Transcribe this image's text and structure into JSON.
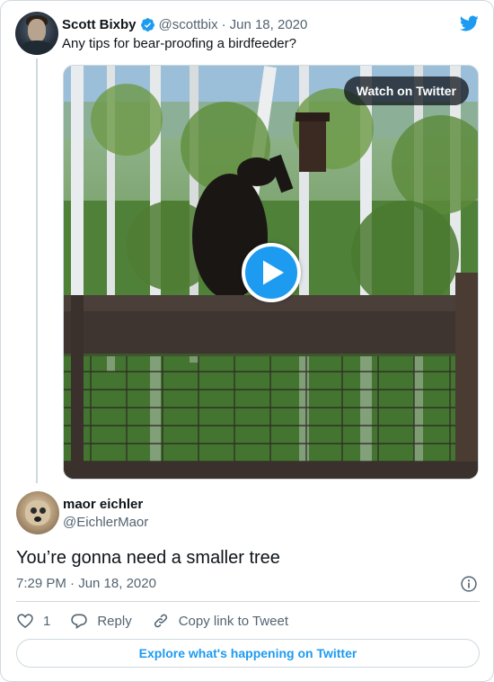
{
  "parent_tweet": {
    "author_name": "Scott Bixby",
    "handle": "@scottbix",
    "separator": "·",
    "date": "Jun 18, 2020",
    "text": "Any tips for bear-proofing a birdfeeder?"
  },
  "media": {
    "watch_label": "Watch on Twitter"
  },
  "reply_tweet": {
    "author_name": "maor eichler",
    "handle": "@EichlerMaor",
    "text": "You’re gonna need a smaller tree",
    "timestamp": "7:29 PM · Jun 18, 2020"
  },
  "actions": {
    "like_count": "1",
    "reply_label": "Reply",
    "copy_link_label": "Copy link to Tweet"
  },
  "footer": {
    "explore_label": "Explore what's happening on Twitter"
  },
  "colors": {
    "brand": "#1d9bf0",
    "text": "#0f1419",
    "secondary": "#536471",
    "border": "#cfd9de"
  },
  "icons": [
    "verified-icon",
    "twitter-bird-icon",
    "play-icon",
    "info-icon",
    "heart-icon",
    "reply-bubble-icon",
    "link-icon"
  ]
}
